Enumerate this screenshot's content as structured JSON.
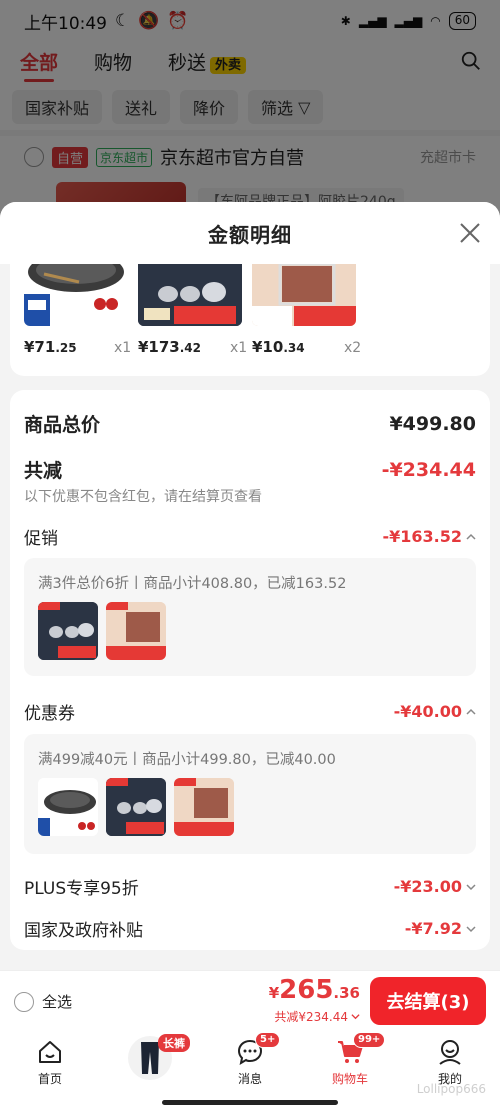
{
  "status_bar": {
    "time": "上午10:49",
    "battery": "60"
  },
  "top_tabs": [
    {
      "label": "全部",
      "active": true
    },
    {
      "label": "购物",
      "active": false
    },
    {
      "label": "秒送",
      "active": false,
      "badge": "外卖"
    }
  ],
  "filters": [
    "国家补贴",
    "送礼",
    "降价",
    "筛选"
  ],
  "store": {
    "tag_self": "自营",
    "tag_market": "京东超市",
    "name": "京东超市官方自营",
    "right_link": "充超市卡"
  },
  "bg_item": {
    "spec": "【东阿品牌正品】阿胶片240g"
  },
  "sheet": {
    "title": "金额明细",
    "products": [
      {
        "price_int": "¥71",
        "price_dec": ".25",
        "qty": "x1"
      },
      {
        "price_int": "¥173",
        "price_dec": ".42",
        "qty": "x1"
      },
      {
        "price_int": "¥10",
        "price_dec": ".34",
        "qty": "x2"
      }
    ],
    "goods_total_label": "商品总价",
    "goods_total_value": "¥499.80",
    "discount_label": "共减",
    "discount_value": "-¥234.44",
    "discount_note": "以下优惠不包含红包，请在结算页查看",
    "promo": {
      "label": "促销",
      "value": "-¥163.52",
      "detail": "满3件总价6折丨商品小计408.80，已减163.52"
    },
    "coupon": {
      "label": "优惠券",
      "value": "-¥40.00",
      "detail": "满499减40元丨商品小计499.80，已减40.00"
    },
    "plus": {
      "label": "PLUS专享95折",
      "value": "-¥23.00"
    },
    "subsidy": {
      "label": "国家及政府补贴",
      "value": "-¥7.92"
    }
  },
  "checkout": {
    "select_all": "全选",
    "yen": "¥",
    "total_int": "265",
    "total_dec": ".36",
    "saved": "共减¥234.44",
    "button": "去结算(3)"
  },
  "tabbar": {
    "items": [
      {
        "label": "首页"
      },
      {
        "label": "消息",
        "badge": "5+"
      },
      {
        "label": "购物车",
        "badge": "99+"
      },
      {
        "label": "我的"
      }
    ],
    "pants_label": "长裤"
  },
  "watermark": "Lollipop666",
  "colors": {
    "accent": "#e4393c",
    "button": "#f0242a",
    "market_green": "#2eae5a"
  }
}
